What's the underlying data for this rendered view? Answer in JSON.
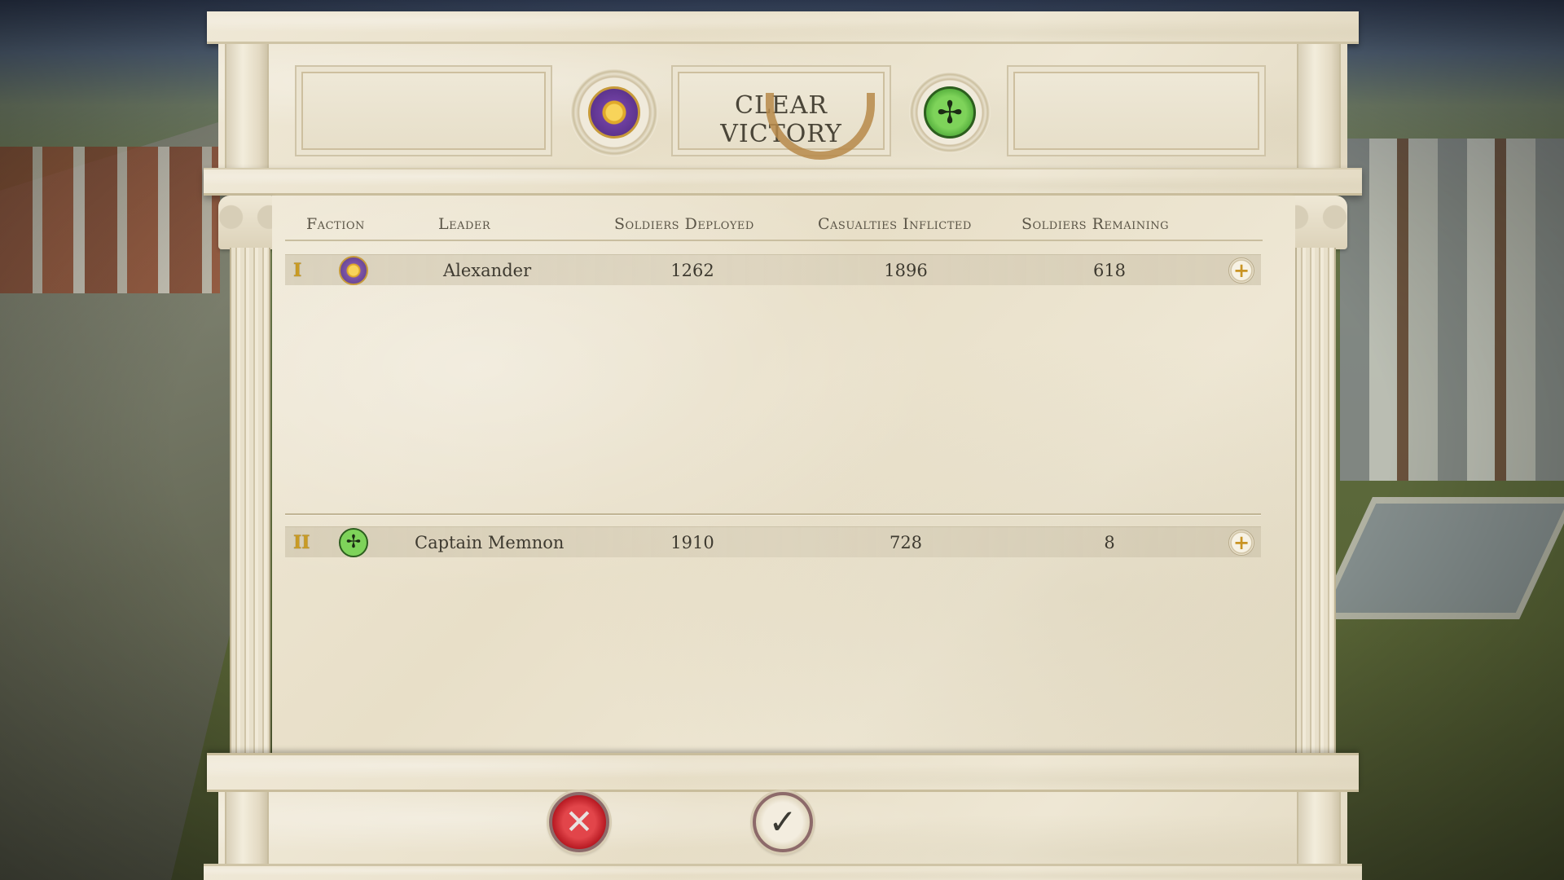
{
  "header": {
    "result": "CLEAR VICTORY",
    "left_faction_icon": "sun-emblem-icon",
    "right_faction_icon": "eagle-emblem-icon",
    "left_laurel_icon": "laurel-wreath-icon"
  },
  "table": {
    "columns": {
      "faction": "Faction",
      "leader": "Leader",
      "deployed": "Soldiers Deployed",
      "inflicted": "Casualties Inflicted",
      "remaining": "Soldiers Remaining"
    },
    "rows": [
      {
        "rank": "I",
        "faction_icon": "sun-emblem-icon",
        "leader": "Alexander",
        "deployed": "1262",
        "inflicted": "1896",
        "remaining": "618",
        "expand_icon": "plus-icon"
      },
      {
        "rank": "II",
        "faction_icon": "eagle-emblem-icon",
        "leader": "Captain Memnon",
        "deployed": "1910",
        "inflicted": "728",
        "remaining": "8",
        "expand_icon": "plus-icon"
      }
    ]
  },
  "footer": {
    "cancel_icon": "crossed-swords-icon",
    "confirm_icon": "checkmark-icon"
  },
  "colors": {
    "marble": "#efe8d6",
    "text": "#3e3a30",
    "rank_gold": "#c99b24",
    "macedon_purple": "#5a3a84",
    "eagle_green": "#3d9a2c",
    "cancel_red": "#b3151e"
  }
}
